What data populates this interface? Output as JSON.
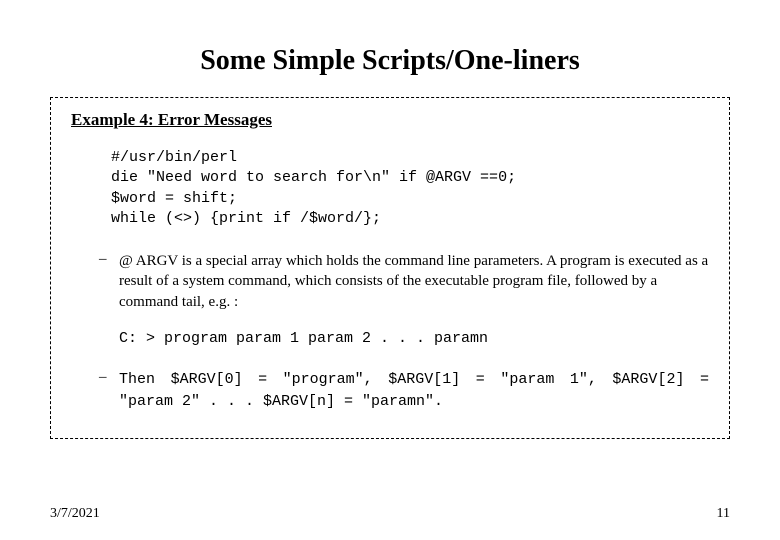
{
  "title": "Some Simple Scripts/One-liners",
  "example_label": "Example 4: Error Messages",
  "code": "#/usr/bin/perl\ndie \"Need word to search for\\n\" if @ARGV ==0;\n$word = shift;\nwhile (<>) {print if /$word/};",
  "bullet1": "@ ARGV is a special array which holds the command line parameters. A program is executed as a result of a system command, which consists of the executable program file, followed by a command tail, e.g. :",
  "cmd_example": "C: > program param 1 param 2 . . . paramn",
  "bullet2_then": "Then ",
  "bullet2_rest": "$ARGV[0] = \"program\", $ARGV[1] = \"param 1\", $ARGV[2] = \"param 2\" . . . $ARGV[n] = \"paramn\".",
  "footer_date": "3/7/2021",
  "footer_page": "11"
}
